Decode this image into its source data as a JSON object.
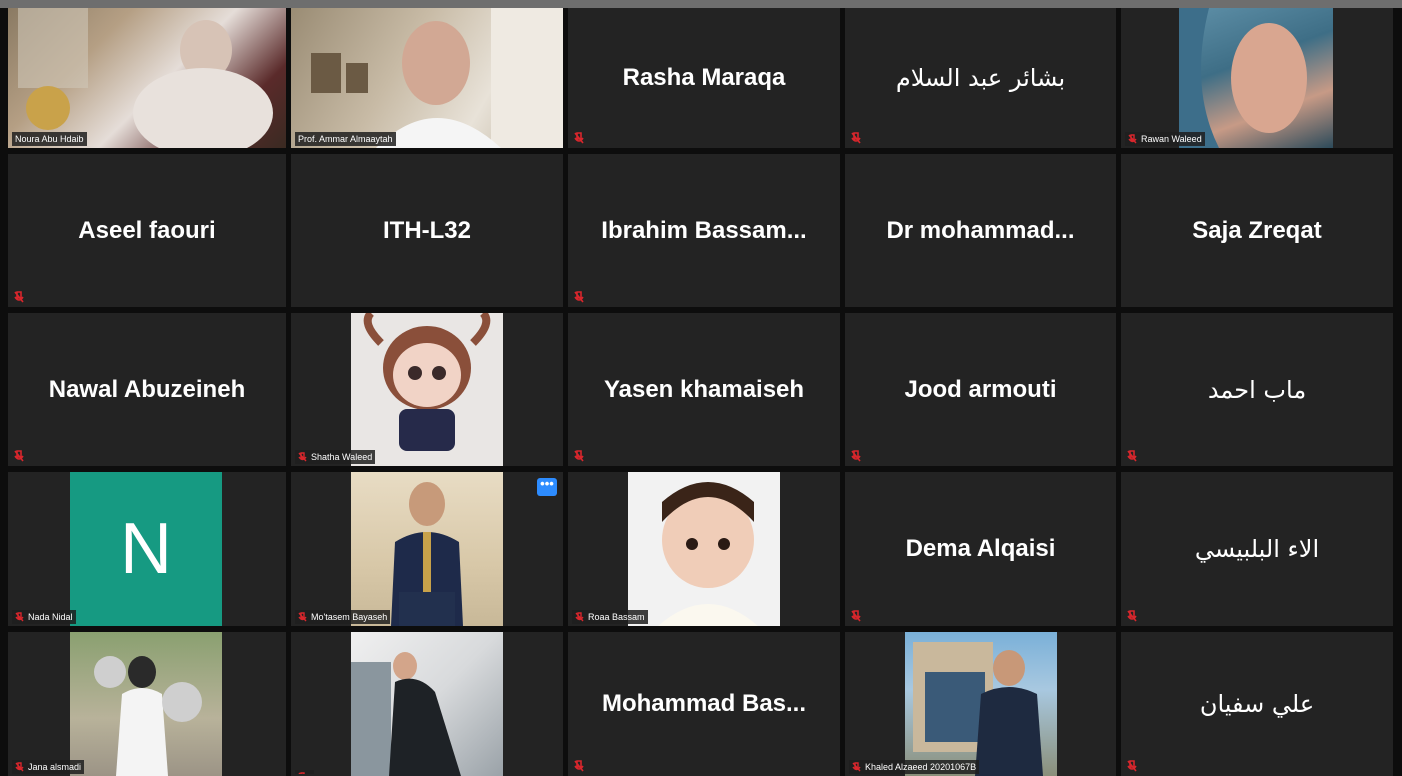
{
  "participants": [
    {
      "name": "Noura Abu Hdaib",
      "has_video": true,
      "active": true,
      "muted": false
    },
    {
      "name": "Prof. Ammar Almaaytah",
      "has_video": true,
      "muted": false
    },
    {
      "name": "Rasha Maraqa",
      "has_video": false,
      "muted": true
    },
    {
      "name": "بشائر عبد السلام",
      "has_video": false,
      "muted": true
    },
    {
      "name": "Rawan Waleed",
      "has_video": true,
      "muted": true
    },
    {
      "name": "Aseel faouri",
      "has_video": false,
      "muted": true
    },
    {
      "name": "ITH-L32",
      "has_video": false,
      "muted": false
    },
    {
      "name": "Ibrahim  Bassam...",
      "has_video": false,
      "muted": true
    },
    {
      "name": "Dr  mohammad...",
      "has_video": false,
      "muted": false
    },
    {
      "name": "Saja Zreqat",
      "has_video": false,
      "muted": false
    },
    {
      "name": "Nawal Abuzeineh",
      "has_video": false,
      "muted": true
    },
    {
      "name": "Shatha Waleed",
      "has_video": true,
      "muted": true
    },
    {
      "name": "Yasen khamaiseh",
      "has_video": false,
      "muted": true
    },
    {
      "name": "Jood armouti",
      "has_video": false,
      "muted": true
    },
    {
      "name": "ماب احمد",
      "has_video": false,
      "muted": true
    },
    {
      "name": "Nada Nidal",
      "has_video": false,
      "avatar_letter": "N",
      "avatar_color": "#169a82",
      "muted": true
    },
    {
      "name": "Mo'tasem Bayaseh",
      "has_video": true,
      "muted": true,
      "menu_label": "•••"
    },
    {
      "name": "Roaa Bassam",
      "has_video": true,
      "muted": true
    },
    {
      "name": "Dema Alqaisi",
      "has_video": false,
      "muted": true
    },
    {
      "name": "الاء البلبيسي",
      "has_video": false,
      "muted": true
    },
    {
      "name": "Jana alsmadi",
      "has_video": true,
      "muted": true
    },
    {
      "name": "",
      "has_video": true,
      "muted": true
    },
    {
      "name": "Mohammad  Bas...",
      "has_video": false,
      "muted": true
    },
    {
      "name": "Khaled Alzaeed 20201067B",
      "has_video": true,
      "muted": true
    },
    {
      "name": "علي سفيان",
      "has_video": false,
      "muted": true
    }
  ],
  "colors": {
    "accent": "#2d8cff",
    "active_border": "#b9dc4a",
    "mute": "#d9262c",
    "tile_bg": "#232323"
  }
}
